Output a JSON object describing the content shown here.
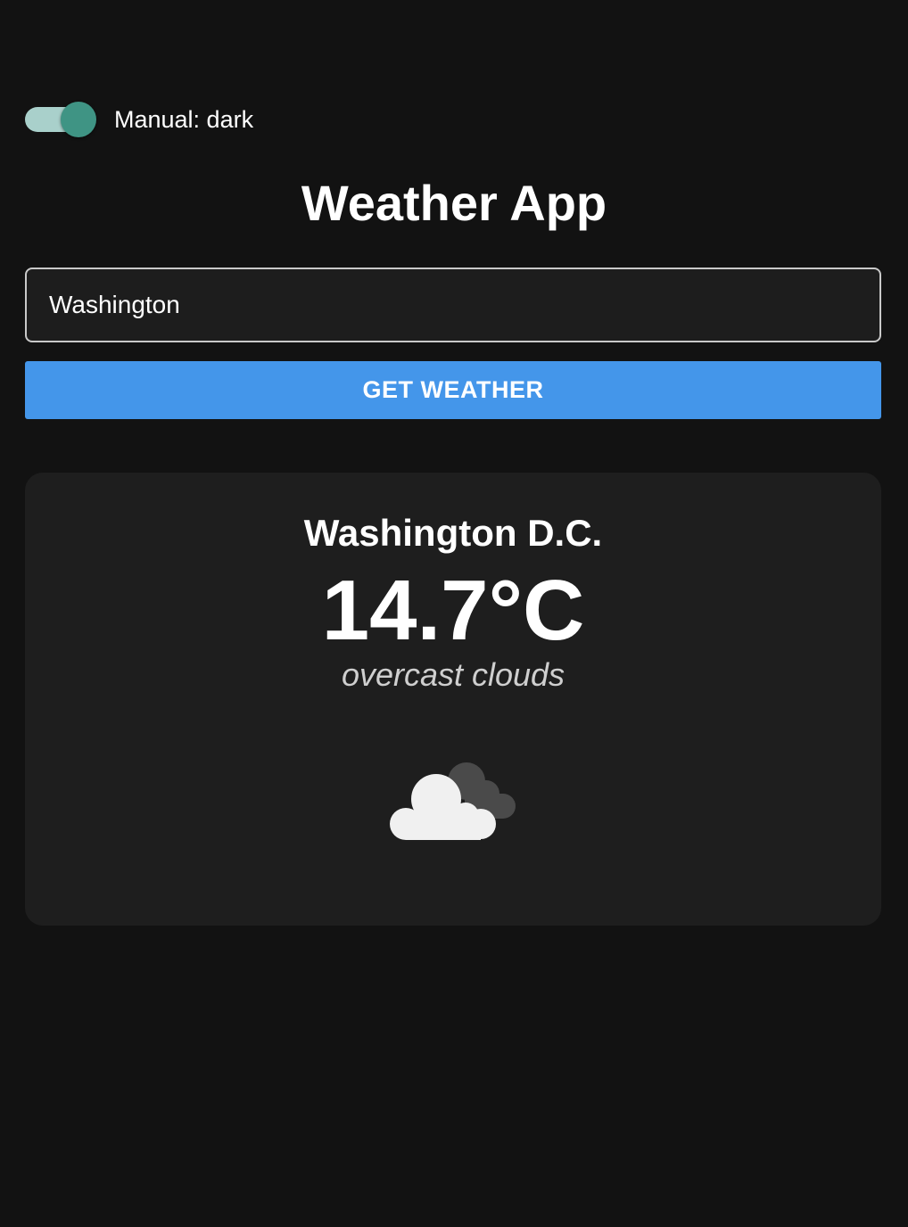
{
  "theme_toggle": {
    "label": "Manual: dark",
    "state": "on"
  },
  "header": {
    "title": "Weather App"
  },
  "search": {
    "value": "Washington",
    "button_label": "GET WEATHER"
  },
  "weather": {
    "city": "Washington D.C.",
    "temperature": "14.7°C",
    "description": "overcast clouds",
    "icon": "overcast-clouds-icon"
  },
  "colors": {
    "background": "#121212",
    "card": "#1e1e1e",
    "button": "#4496ea",
    "toggle_thumb": "#3f9484",
    "toggle_track": "#a9d0cb"
  }
}
